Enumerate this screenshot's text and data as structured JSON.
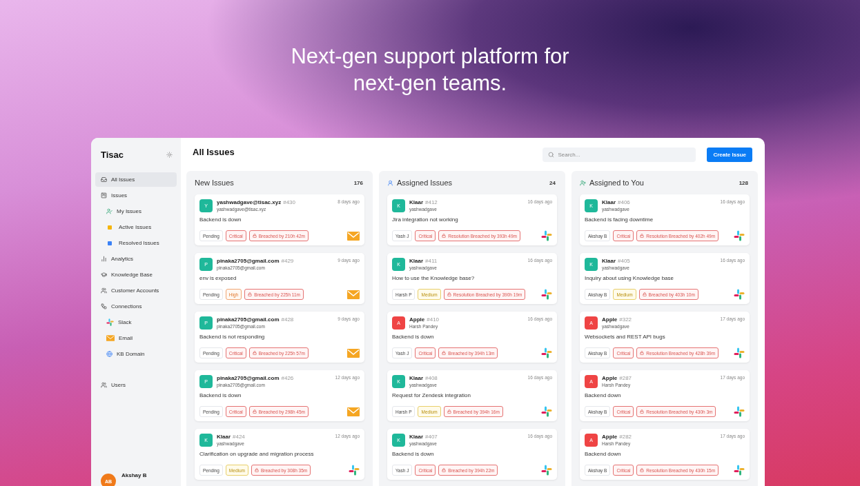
{
  "headline": "Next-gen support platform for next-gen teams.",
  "app": {
    "brand": "Tisac",
    "sidebar": {
      "items": [
        {
          "label": "All Issues",
          "selected": true
        },
        {
          "label": "Issues",
          "selected": false,
          "children": [
            {
              "label": "My Issues",
              "selected": false
            },
            {
              "label": "Active Issues",
              "selected": false,
              "color": "#f5b50b"
            },
            {
              "label": "Resolved Issues",
              "selected": false,
              "color": "#3b82f6"
            }
          ]
        },
        {
          "label": "Analytics",
          "selected": false
        },
        {
          "label": "Knowledge Base",
          "selected": false
        },
        {
          "label": "Customer Accounts",
          "selected": false
        },
        {
          "label": "Connections",
          "selected": false,
          "children": [
            {
              "label": "Slack",
              "selected": false
            },
            {
              "label": "Email",
              "selected": false
            },
            {
              "label": "KB Domain",
              "selected": false
            }
          ]
        },
        {
          "label": "Users",
          "selected": false
        }
      ],
      "user": {
        "initials": "AB",
        "name": "Akshay B"
      }
    },
    "page_title": "All Issues",
    "search": {
      "placeholder": "Search..."
    },
    "create_button": "Create Issue",
    "columns": [
      {
        "title": "New Issues",
        "count": "176",
        "cards": [
          {
            "avatar": "Y",
            "color": "#1fb89a",
            "name": "yashwadgave@tisac.xyz",
            "number": "#430",
            "sub": "yashwadgave@tisac.xyz",
            "time": "8 days ago",
            "subject": "Backend is down",
            "assignee": "Pending",
            "priority": {
              "kind": "critical",
              "label": "Critical"
            },
            "breach": "Breached by 210h 42m",
            "kind": "email"
          },
          {
            "avatar": "P",
            "color": "#1fb89a",
            "name": "pinaka2705@gmail.com",
            "number": "#429",
            "sub": "pinaka2705@gmail.com",
            "time": "9 days ago",
            "subject": "env is exposed",
            "assignee": "Pending",
            "priority": {
              "kind": "high",
              "label": "High"
            },
            "breach": "Breached by 225h 11m",
            "kind": "email"
          },
          {
            "avatar": "P",
            "color": "#1fb89a",
            "name": "pinaka2705@gmail.com",
            "number": "#428",
            "sub": "pinaka2705@gmail.com",
            "time": "9 days ago",
            "subject": "Backend is not responding",
            "assignee": "Pending",
            "priority": {
              "kind": "critical",
              "label": "Critical"
            },
            "breach": "Breached by 225h 57m",
            "kind": "email"
          },
          {
            "avatar": "P",
            "color": "#1fb89a",
            "name": "pinaka2705@gmail.com",
            "number": "#426",
            "sub": "pinaka2705@gmail.com",
            "time": "12 days ago",
            "subject": "Backend is down",
            "assignee": "Pending",
            "priority": {
              "kind": "critical",
              "label": "Critical"
            },
            "breach": "Breached by 298h 45m",
            "kind": "email"
          },
          {
            "avatar": "K",
            "color": "#1fb89a",
            "name": "Klaar",
            "number": "#424",
            "sub": "yashwadgave",
            "time": "12 days ago",
            "subject": "Clarification on upgrade and migration process",
            "assignee": "Pending",
            "priority": {
              "kind": "medium",
              "label": "Medium"
            },
            "breach": "Breached by 308h 35m",
            "kind": "slack"
          }
        ]
      },
      {
        "title": "Assigned Issues",
        "count": "24",
        "cards": [
          {
            "avatar": "K",
            "color": "#1fb89a",
            "name": "Klaar",
            "number": "#412",
            "sub": "yashwadgave",
            "time": "16 days ago",
            "subject": "Jira integration not working",
            "assignee": "Yash J",
            "priority": {
              "kind": "critical",
              "label": "Critical"
            },
            "breach": "Resolution Breached by 393h 49m",
            "kind": "slack"
          },
          {
            "avatar": "K",
            "color": "#1fb89a",
            "name": "Klaar",
            "number": "#411",
            "sub": "yashwadgave",
            "time": "16 days ago",
            "subject": "How to use the Knowledge base?",
            "assignee": "Harsh P",
            "priority": {
              "kind": "medium",
              "label": "Medium"
            },
            "breach": "Resolution Breached by 390h 19m",
            "kind": "slack"
          },
          {
            "avatar": "A",
            "color": "#ef4444",
            "name": "Apple",
            "number": "#410",
            "sub": "Harsh Pandey",
            "time": "16 days ago",
            "subject": "Backend is down",
            "assignee": "Yash J",
            "priority": {
              "kind": "critical",
              "label": "Critical"
            },
            "breach": "Breached by 394h 13m",
            "kind": "slack"
          },
          {
            "avatar": "K",
            "color": "#1fb89a",
            "name": "Klaar",
            "number": "#408",
            "sub": "yashwadgave",
            "time": "16 days ago",
            "subject": "Request for Zendesk integration",
            "assignee": "Harsh P",
            "priority": {
              "kind": "medium",
              "label": "Medium"
            },
            "breach": "Breached by 394h 16m",
            "kind": "slack"
          },
          {
            "avatar": "K",
            "color": "#1fb89a",
            "name": "Klaar",
            "number": "#407",
            "sub": "yashwadgave",
            "time": "16 days ago",
            "subject": "Backend is down",
            "assignee": "Yash J",
            "priority": {
              "kind": "critical",
              "label": "Critical"
            },
            "breach": "Breached by 394h 22m",
            "kind": "slack"
          }
        ]
      },
      {
        "title": "Assigned to You",
        "count": "128",
        "cards": [
          {
            "avatar": "K",
            "color": "#1fb89a",
            "name": "Klaar",
            "number": "#406",
            "sub": "yashwadgave",
            "time": "16 days ago",
            "subject": "Backend is facing downtime",
            "assignee": "Akshay B",
            "priority": {
              "kind": "critical",
              "label": "Critical"
            },
            "breach": "Resolution Breached by 402h 49m",
            "kind": "slack"
          },
          {
            "avatar": "K",
            "color": "#1fb89a",
            "name": "Klaar",
            "number": "#405",
            "sub": "yashwadgave",
            "time": "16 days ago",
            "subject": "Inquiry about using Knowledge base",
            "assignee": "Akshay B",
            "priority": {
              "kind": "medium",
              "label": "Medium"
            },
            "breach": "Breached by 403h 10m",
            "kind": "slack"
          },
          {
            "avatar": "A",
            "color": "#ef4444",
            "name": "Apple",
            "number": "#322",
            "sub": "yashwadgave",
            "time": "17 days ago",
            "subject": "Websockets and REST API bugs",
            "assignee": "Akshay B",
            "priority": {
              "kind": "critical",
              "label": "Critical"
            },
            "breach": "Resolution Breached by 428h 39m",
            "kind": "slack"
          },
          {
            "avatar": "A",
            "color": "#ef4444",
            "name": "Apple",
            "number": "#287",
            "sub": "Harsh Pandey",
            "time": "17 days ago",
            "subject": "Backend down",
            "assignee": "Akshay B",
            "priority": {
              "kind": "critical",
              "label": "Critical"
            },
            "breach": "Resolution Breached by 430h 3m",
            "kind": "slack"
          },
          {
            "avatar": "A",
            "color": "#ef4444",
            "name": "Apple",
            "number": "#282",
            "sub": "Harsh Pandey",
            "time": "17 days ago",
            "subject": "Backend down",
            "assignee": "Akshay B",
            "priority": {
              "kind": "critical",
              "label": "Critical"
            },
            "breach": "Resolution Breached by 430h 15m",
            "kind": "slack"
          }
        ]
      }
    ]
  }
}
